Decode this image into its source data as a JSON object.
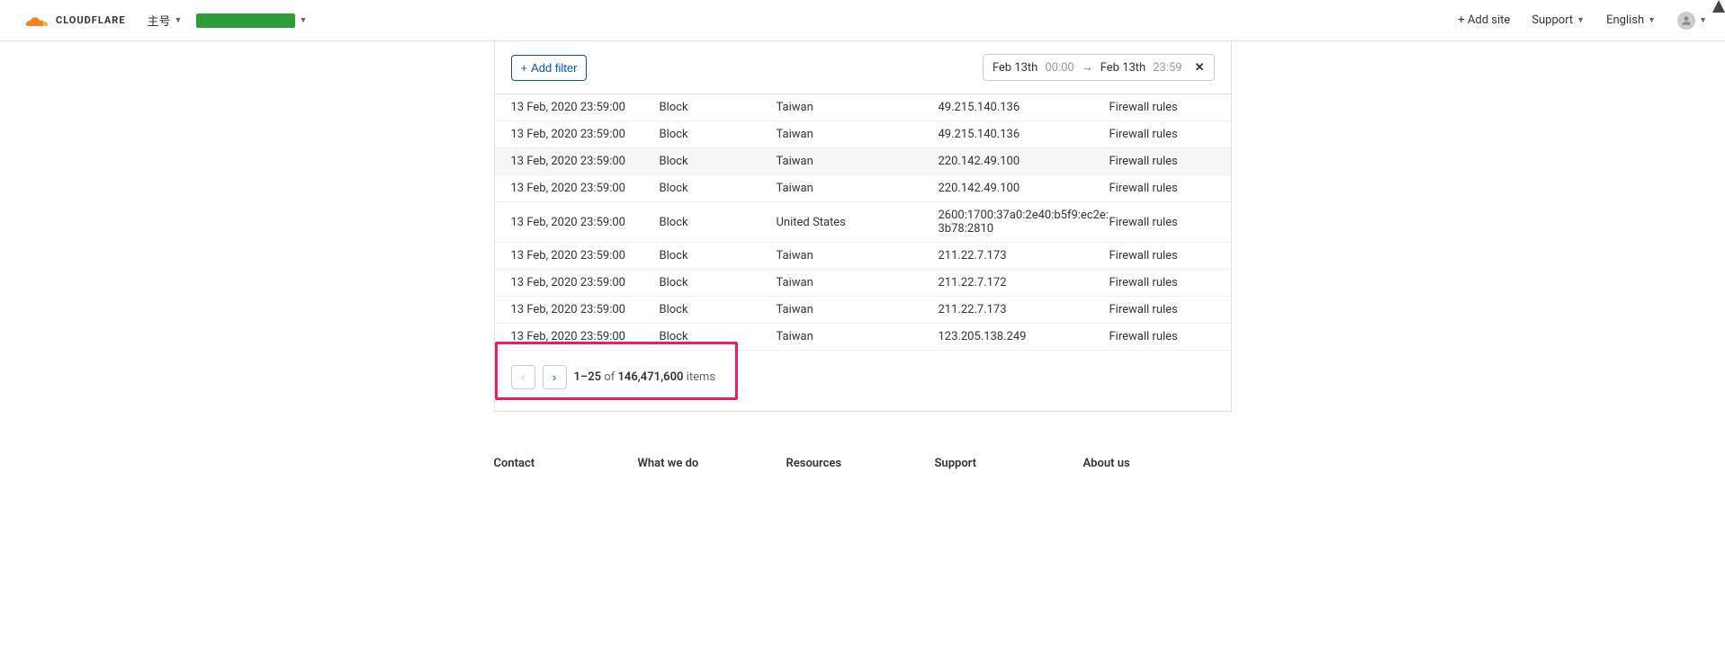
{
  "header": {
    "brand": "CLOUDFLARE",
    "account_label": "主号",
    "add_site": "+ Add site",
    "support": "Support",
    "language": "English"
  },
  "filter": {
    "add_filter_label": "Add filter",
    "date_from": "Feb 13th",
    "time_from": "00:00",
    "date_to": "Feb 13th",
    "time_to": "23:59"
  },
  "rows": [
    {
      "date": "13 Feb, 2020 23:59:00",
      "action": "Block",
      "country": "Taiwan",
      "ip": "49.215.140.136",
      "service": "Firewall rules"
    },
    {
      "date": "13 Feb, 2020 23:59:00",
      "action": "Block",
      "country": "Taiwan",
      "ip": "49.215.140.136",
      "service": "Firewall rules"
    },
    {
      "date": "13 Feb, 2020 23:59:00",
      "action": "Block",
      "country": "Taiwan",
      "ip": "220.142.49.100",
      "service": "Firewall rules"
    },
    {
      "date": "13 Feb, 2020 23:59:00",
      "action": "Block",
      "country": "Taiwan",
      "ip": "220.142.49.100",
      "service": "Firewall rules"
    },
    {
      "date": "13 Feb, 2020 23:59:00",
      "action": "Block",
      "country": "United States",
      "ip": "2600:1700:37a0:2e40:b5f9:ec2e:3b78:2810",
      "service": "Firewall rules"
    },
    {
      "date": "13 Feb, 2020 23:59:00",
      "action": "Block",
      "country": "Taiwan",
      "ip": "211.22.7.173",
      "service": "Firewall rules"
    },
    {
      "date": "13 Feb, 2020 23:59:00",
      "action": "Block",
      "country": "Taiwan",
      "ip": "211.22.7.172",
      "service": "Firewall rules"
    },
    {
      "date": "13 Feb, 2020 23:59:00",
      "action": "Block",
      "country": "Taiwan",
      "ip": "211.22.7.173",
      "service": "Firewall rules"
    },
    {
      "date": "13 Feb, 2020 23:59:00",
      "action": "Block",
      "country": "Taiwan",
      "ip": "123.205.138.249",
      "service": "Firewall rules"
    }
  ],
  "pager": {
    "range": "1–25",
    "of": "of",
    "total": "146,471,600",
    "items": "items"
  },
  "footer": {
    "contact": "Contact",
    "what_we_do": "What we do",
    "resources": "Resources",
    "support": "Support",
    "about_us": "About us"
  }
}
